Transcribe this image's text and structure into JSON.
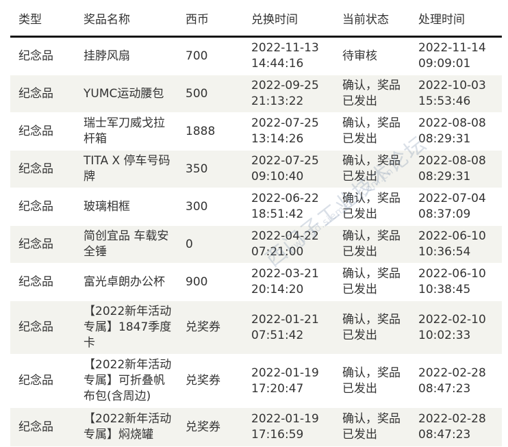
{
  "table": {
    "headers": {
      "type": "类型",
      "name": "奖品名称",
      "coin": "西币",
      "redeem_time": "兑换时间",
      "status": "当前状态",
      "process_time": "处理时间"
    },
    "rows": [
      {
        "type": "纪念品",
        "name": "挂脖风扇",
        "coin": "700",
        "redeem_date": "2022-11-13",
        "redeem_clock": "14:44:16",
        "status": "待审核",
        "proc_date": "2022-11-14",
        "proc_clock": "09:09:01"
      },
      {
        "type": "纪念品",
        "name": "YUMC运动腰包",
        "coin": "500",
        "redeem_date": "2022-09-25",
        "redeem_clock": "21:13:22",
        "status": "确认，奖品已发出",
        "proc_date": "2022-10-03",
        "proc_clock": "15:53:46"
      },
      {
        "type": "纪念品",
        "name": "瑞士军刀威戈拉杆箱",
        "coin": "1888",
        "redeem_date": "2022-07-25",
        "redeem_clock": "13:14:26",
        "status": "确认，奖品已发出",
        "proc_date": "2022-08-08",
        "proc_clock": "08:29:31"
      },
      {
        "type": "纪念品",
        "name": "TITA X 停车号码牌",
        "coin": "350",
        "redeem_date": "2022-07-25",
        "redeem_clock": "09:10:40",
        "status": "确认，奖品已发出",
        "proc_date": "2022-08-08",
        "proc_clock": "08:29:31"
      },
      {
        "type": "纪念品",
        "name": "玻璃相框",
        "coin": "300",
        "redeem_date": "2022-06-22",
        "redeem_clock": "18:51:42",
        "status": "确认，奖品已发出",
        "proc_date": "2022-07-04",
        "proc_clock": "08:37:09"
      },
      {
        "type": "纪念品",
        "name": "简创宜品 车载安全锤",
        "coin": "0",
        "redeem_date": "2022-04-22",
        "redeem_clock": "07:21:00",
        "status": "确认，奖品已发出",
        "proc_date": "2022-06-10",
        "proc_clock": "10:36:54"
      },
      {
        "type": "纪念品",
        "name": "富光卓朗办公杯",
        "coin": "900",
        "redeem_date": "2022-03-21",
        "redeem_clock": "20:14:20",
        "status": "确认，奖品已发出",
        "proc_date": "2022-06-10",
        "proc_clock": "10:38:45"
      },
      {
        "type": "纪念品",
        "name": "【2022新年活动专属】1847季度卡",
        "coin": "兑奖券",
        "redeem_date": "2022-01-21",
        "redeem_clock": "07:51:42",
        "status": "确认，奖品已发出",
        "proc_date": "2022-02-10",
        "proc_clock": "10:02:33"
      },
      {
        "type": "纪念品",
        "name": "【2022新年活动专属】可折叠帆布包(含周边)",
        "coin": "兑奖券",
        "redeem_date": "2022-01-19",
        "redeem_clock": "17:20:47",
        "status": "确认，奖品已发出",
        "proc_date": "2022-02-28",
        "proc_clock": "08:47:23"
      },
      {
        "type": "纪念品",
        "name": "【2022新年活动专属】焖烧罐",
        "coin": "兑奖券",
        "redeem_date": "2022-01-19",
        "redeem_clock": "17:16:59",
        "status": "确认，奖品已发出",
        "proc_date": "2022-02-28",
        "proc_clock": "08:47:23"
      }
    ]
  },
  "watermark": {
    "main": "西门子工业技术论坛",
    "sub": "www.ad.siemens.com.cn"
  }
}
